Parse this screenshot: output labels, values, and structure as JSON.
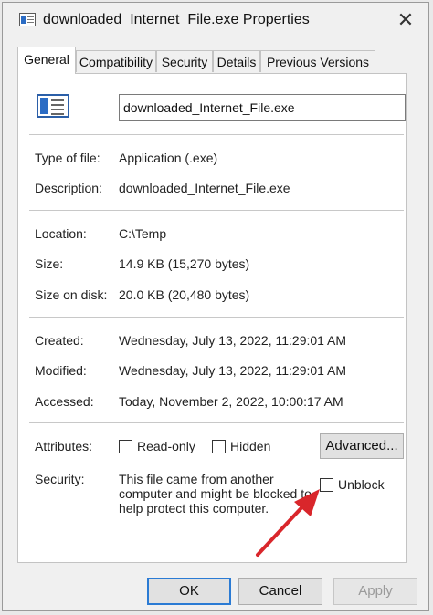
{
  "window": {
    "title": "downloaded_Internet_File.exe Properties",
    "close_glyph": "✕"
  },
  "tabs": [
    {
      "label": "General",
      "active": true
    },
    {
      "label": "Compatibility"
    },
    {
      "label": "Security"
    },
    {
      "label": "Details"
    },
    {
      "label": "Previous Versions"
    }
  ],
  "general": {
    "file_name": "downloaded_Internet_File.exe",
    "type": {
      "label": "Type of file:",
      "value": "Application (.exe)"
    },
    "description": {
      "label": "Description:",
      "value": "downloaded_Internet_File.exe"
    },
    "location": {
      "label": "Location:",
      "value": "C:\\Temp"
    },
    "size": {
      "label": "Size:",
      "value": "14.9 KB (15,270 bytes)"
    },
    "size_on_disk": {
      "label": "Size on disk:",
      "value": "20.0 KB (20,480 bytes)"
    },
    "created": {
      "label": "Created:",
      "value": "Wednesday, July 13, 2022, 11:29:01 AM"
    },
    "modified": {
      "label": "Modified:",
      "value": "Wednesday, July 13, 2022, 11:29:01 AM"
    },
    "accessed": {
      "label": "Accessed:",
      "value": "Today, November 2, 2022, 10:00:17 AM"
    },
    "attributes": {
      "label": "Attributes:",
      "read_only": "Read-only",
      "hidden": "Hidden",
      "advanced_button": "Advanced..."
    },
    "security": {
      "label": "Security:",
      "text": "This file came from another computer and might be blocked to help protect this computer.",
      "unblock": "Unblock"
    }
  },
  "buttons": {
    "ok": "OK",
    "cancel": "Cancel",
    "apply": "Apply"
  },
  "colors": {
    "annotation_arrow": "#d9262b",
    "default_button_border": "#2b7bd4"
  },
  "icons": {
    "title": "exe-window-icon",
    "file": "exe-window-icon"
  }
}
